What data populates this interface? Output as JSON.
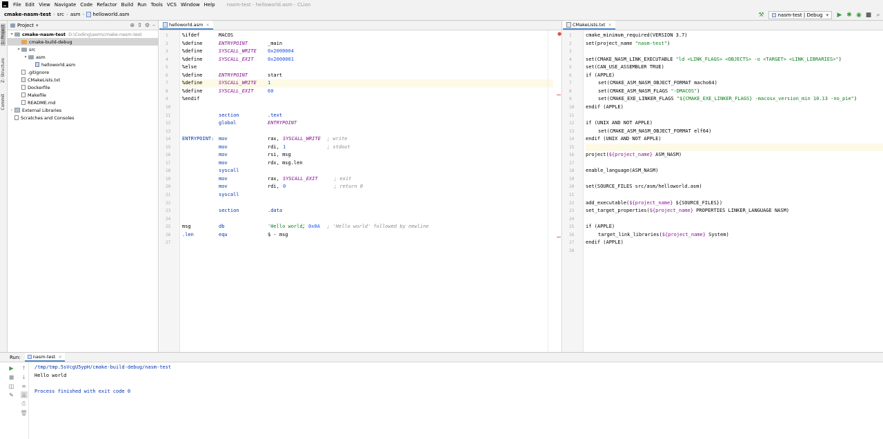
{
  "menubar": {
    "items": [
      "File",
      "Edit",
      "View",
      "Navigate",
      "Code",
      "Refactor",
      "Build",
      "Run",
      "Tools",
      "VCS",
      "Window",
      "Help"
    ],
    "window_title": "nasm-test - helloworld.asm - CLion"
  },
  "navbar": {
    "breadcrumbs": [
      "cmake-nasm-test",
      "src",
      "asm",
      "helloworld.asm"
    ],
    "run_config": "nasm-test | Debug"
  },
  "left_strip": {
    "tabs": [
      "1: Project",
      "Z: Structure",
      "Commit"
    ]
  },
  "project": {
    "title": "Project",
    "tree": [
      {
        "label": "cmake-nasm-test",
        "path": "D:\\Coding\\asm\\cmake-nasm-test",
        "type": "root"
      },
      {
        "label": "cmake-build-debug",
        "type": "folder-build",
        "selected": true
      },
      {
        "label": "src",
        "type": "folder"
      },
      {
        "label": "asm",
        "type": "folder"
      },
      {
        "label": "helloworld.asm",
        "type": "asm"
      },
      {
        "label": ".gitignore",
        "type": "file"
      },
      {
        "label": "CMakeLists.txt",
        "type": "txt"
      },
      {
        "label": "Dockerfile",
        "type": "file"
      },
      {
        "label": "Makefile",
        "type": "file"
      },
      {
        "label": "README.md",
        "type": "file"
      },
      {
        "label": "External Libraries",
        "type": "lib"
      },
      {
        "label": "Scratches and Consoles",
        "type": "scratch"
      }
    ]
  },
  "editor_left": {
    "tab": "helloworld.asm",
    "line_count": 27,
    "highlight_line": 7
  },
  "editor_right": {
    "tab": "CMakeLists.txt",
    "line_count": 28,
    "highlight_line": 15
  },
  "run": {
    "label": "Run:",
    "tab": "nasm-test",
    "lines": [
      "/tmp/tmp.5sVcgU5ypH/cmake-build-debug/nasm-test",
      "Hello world",
      "",
      "Process finished with exit code 0"
    ]
  },
  "colors": {
    "accent": "#4a88c7",
    "macro": "#871094",
    "number": "#1750eb",
    "string": "#067d17",
    "comment": "#8c8c8c"
  }
}
